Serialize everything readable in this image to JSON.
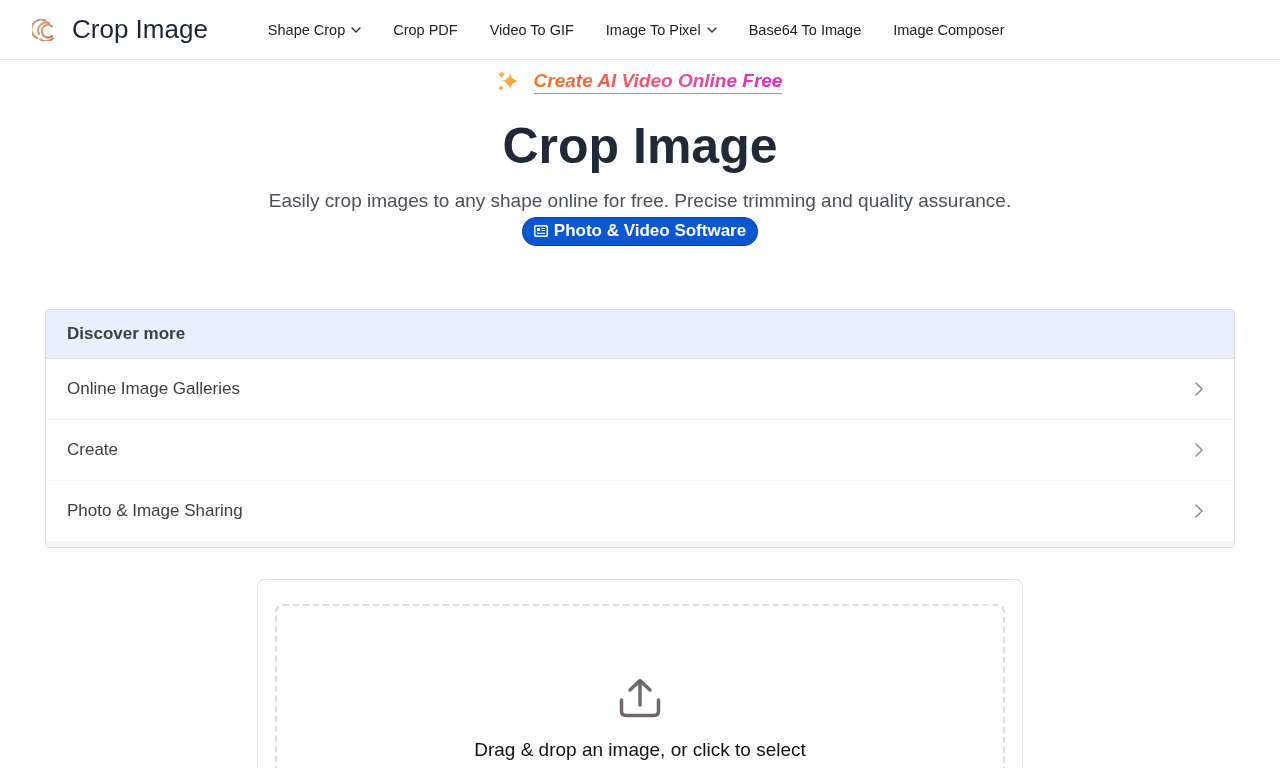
{
  "header": {
    "logo_text": "Crop Image",
    "nav": [
      {
        "label": "Shape Crop",
        "has_menu": true
      },
      {
        "label": "Crop PDF",
        "has_menu": false
      },
      {
        "label": "Video To GIF",
        "has_menu": false
      },
      {
        "label": "Image To Pixel",
        "has_menu": true
      },
      {
        "label": "Base64 To Image",
        "has_menu": false
      },
      {
        "label": "Image Composer",
        "has_menu": false
      }
    ]
  },
  "promo": {
    "label": "Create AI Video Online Free"
  },
  "hero": {
    "title": "Crop Image",
    "subtitle": "Easily crop images to any shape online for free. Precise trimming and quality assurance.",
    "badge": "Photo & Video Software"
  },
  "discover": {
    "title": "Discover more",
    "items": [
      "Online Image Galleries",
      "Create",
      "Photo & Image Sharing"
    ]
  },
  "upload": {
    "prompt": "Drag & drop an image, or click to select"
  }
}
